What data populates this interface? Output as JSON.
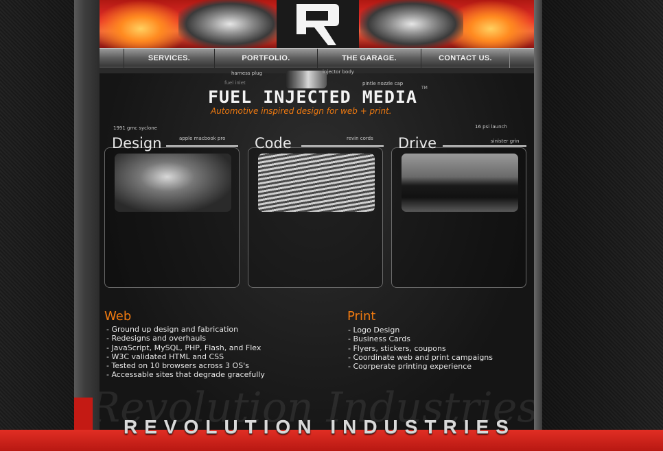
{
  "nav": {
    "items": [
      "SERVICES.",
      "PORTFOLIO.",
      "THE GARAGE.",
      "CONTACT US."
    ]
  },
  "brand": {
    "title": "FUEL INJECTED MEDIA",
    "tagline": "Automotive inspired design for web + print.",
    "tm": "TM"
  },
  "callouts": {
    "harness_plug": "harness plug",
    "injector_body": "injector body",
    "fuel_inlet": "fuel inlet",
    "pintle_nozzle_cap": "pintle nozzle cap",
    "gmc_syclone": "1991 gmc syclone",
    "macbook": "apple macbook pro",
    "revin_cords": "revin cords",
    "psi_launch": "16 psi launch",
    "sinister_grin": "sinister grin"
  },
  "panels": [
    {
      "title": "Design",
      "photo": "car-dashboard-photo"
    },
    {
      "title": "Code",
      "photo": "laptop-keyboard-photo"
    },
    {
      "title": "Drive",
      "photo": "pickup-truck-photo"
    }
  ],
  "web": {
    "heading": "Web",
    "items": [
      "- Ground up design and fabrication",
      "- Redesigns and overhauls",
      "- JavaScript, MySQL, PHP, Flash, and Flex",
      "- W3C validated HTML and CSS",
      "- Tested on 10 browsers across 3 OS's",
      "- Accessable sites that degrade gracefully"
    ]
  },
  "print": {
    "heading": "Print",
    "items": [
      "- Logo Design",
      "- Business Cards",
      "- Flyers, stickers, coupons",
      "- Coordinate web and print campaigns",
      "- Coorperate printing experience"
    ]
  },
  "footer": {
    "title": "REVOLUTION INDUSTRIES",
    "script": "Revolution Industries"
  },
  "colors": {
    "accent_orange": "#f07a10",
    "brand_red": "#c41a14"
  }
}
